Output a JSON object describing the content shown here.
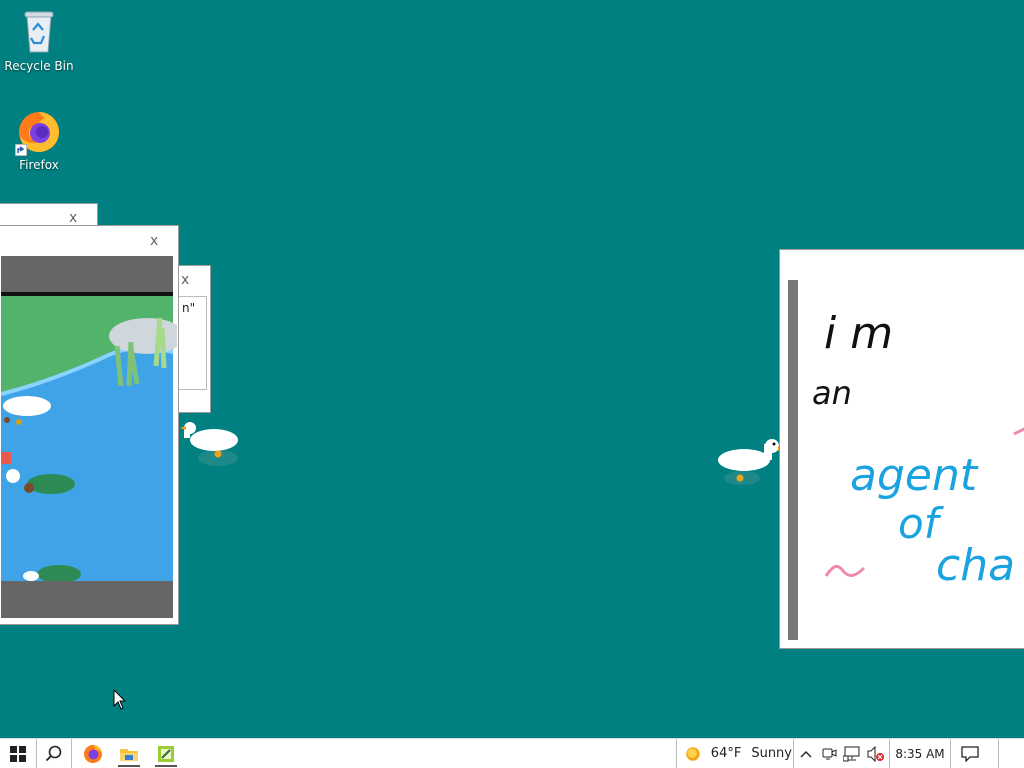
{
  "desktop": {
    "icons": [
      {
        "label": "Recycle Bin",
        "icon": "recycle-bin-icon"
      },
      {
        "label": "Firefox",
        "icon": "firefox-icon"
      }
    ]
  },
  "windows": {
    "close_glyph": "x",
    "partial_text": "n\"",
    "notepad_lines": [
      "i m",
      "an",
      "agent",
      "of",
      "cha"
    ]
  },
  "colors": {
    "desktop": "#008080",
    "ink_black": "#111111",
    "ink_blue": "#1aa3e0",
    "ink_pink": "#f08aa8"
  },
  "taskbar": {
    "start_icon": "windows-start-icon",
    "search_icon": "search-icon",
    "apps": [
      "firefox-icon",
      "file-explorer-icon",
      "notepad-icon"
    ],
    "weather": {
      "temp": "64°F",
      "condition": "Sunny"
    },
    "tray_icons": [
      "chevron-up-icon",
      "meet-now-icon",
      "network-icon",
      "volume-muted-icon"
    ],
    "time": "8:35 AM",
    "notification_icon": "action-center-icon"
  }
}
